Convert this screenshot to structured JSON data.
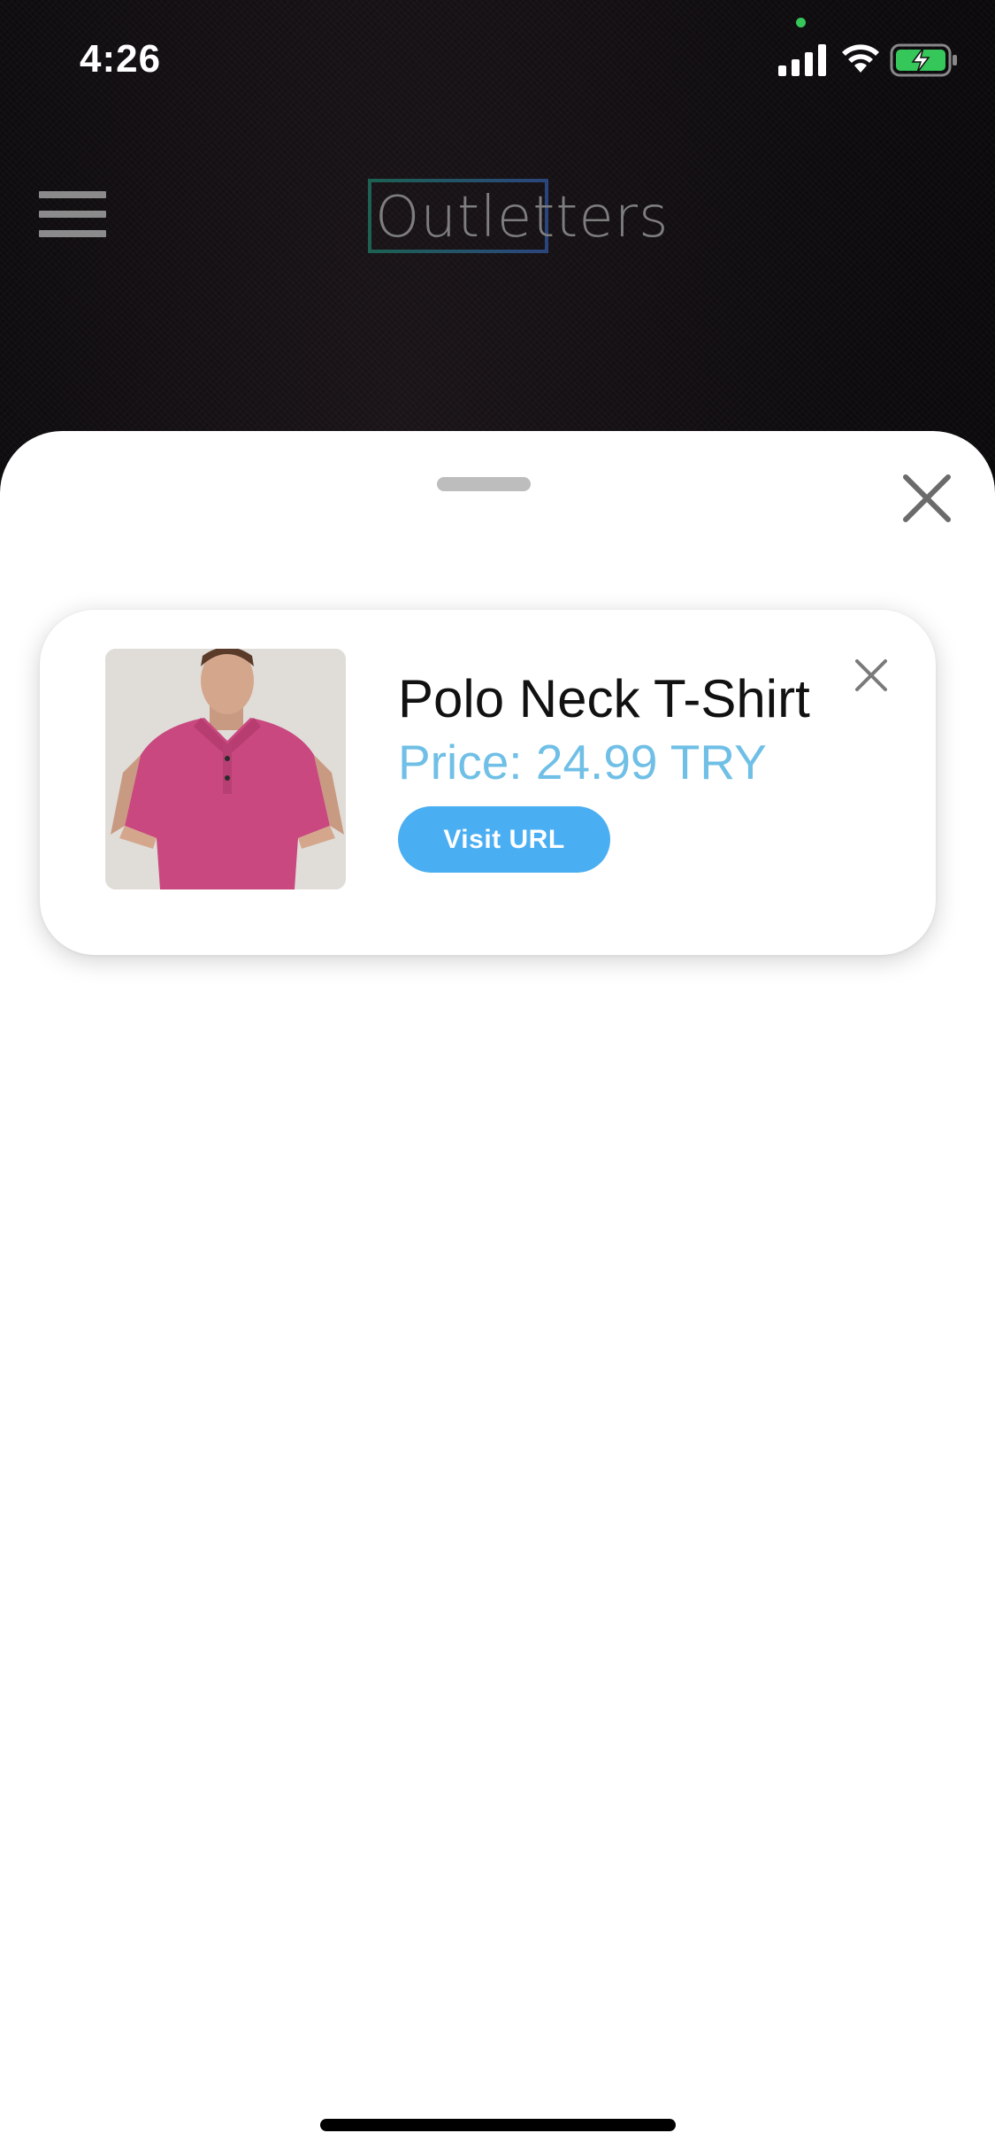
{
  "status_bar": {
    "time": "4:26",
    "signal_icon": "cellular-signal-icon",
    "wifi_icon": "wifi-icon",
    "battery_icon": "battery-charging-icon",
    "privacy_dot_color": "#35c759"
  },
  "header": {
    "menu_icon": "hamburger-menu-icon",
    "brand": "Outletters"
  },
  "sheet": {
    "close_icon": "close-icon",
    "grabber": "drag-handle"
  },
  "product": {
    "title": "Polo Neck T-Shirt",
    "price": "Price: 24.99 TRY",
    "button_label": "Visit URL",
    "close_icon": "close-icon",
    "image": "pink-polo-shirt-photo",
    "price_color": "#6fbfe6",
    "button_color": "#4aaef2"
  }
}
